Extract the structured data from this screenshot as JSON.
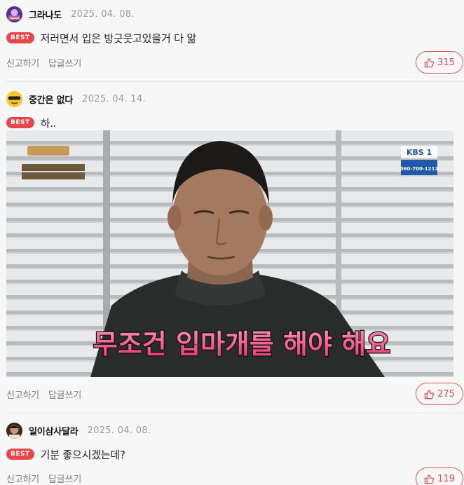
{
  "colors": {
    "accent": "#e8464a",
    "background": "#f7f7f8"
  },
  "comments": [
    {
      "nickname": "그라나도",
      "date": "2025. 04. 08.",
      "badge": "BEST",
      "text": "저러면서 입은 방긋웃고있을거 다 앎",
      "report": "신고하기",
      "reply": "답글쓰기",
      "likes": "315",
      "like_icon": "thumbs-up-icon"
    },
    {
      "nickname": "중간은 없다",
      "date": "2025. 04. 14.",
      "badge": "BEST",
      "text": "하..",
      "image": {
        "caption": "무조건 입마개를 해야 해요",
        "tv_channel": "KBS 1",
        "tv_phone": "060-700-1212"
      },
      "report": "신고하기",
      "reply": "답글쓰기",
      "likes": "275",
      "like_icon": "thumbs-up-icon"
    },
    {
      "nickname": "일이삼사달라",
      "date": "2025. 04. 08.",
      "badge": "BEST",
      "text": "기분 좋으시겠는데?",
      "report": "신고하기",
      "reply": "답글쓰기",
      "likes": "119",
      "like_icon": "thumbs-up-icon"
    }
  ]
}
